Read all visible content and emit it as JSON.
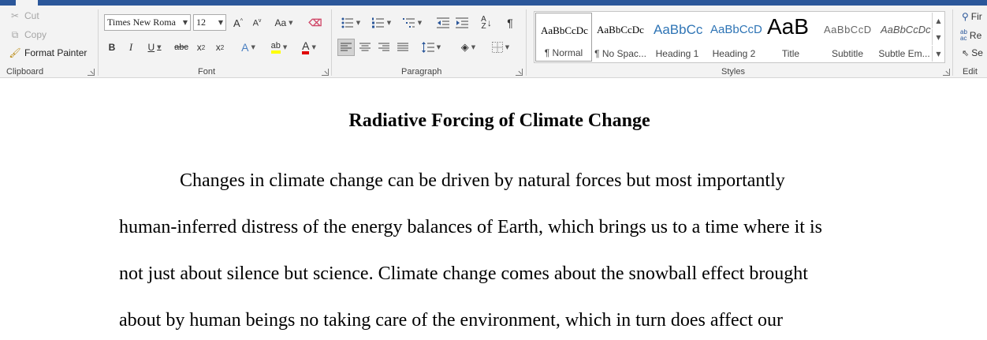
{
  "clipboard": {
    "cut": "Cut",
    "copy": "Copy",
    "format_painter": "Format Painter",
    "group_label": "Clipboard"
  },
  "font": {
    "family": "Times New Roma",
    "size": "12",
    "change_case": "Aa",
    "bold": "B",
    "italic": "I",
    "underline": "U",
    "strikethrough": "abc",
    "subscript": "x",
    "subscript_mark": "2",
    "superscript": "x",
    "superscript_mark": "2",
    "text_effects": "A",
    "font_color": "A",
    "group_label": "Font",
    "highlight_color": "#ffff00",
    "font_color_value": "#e00000"
  },
  "paragraph": {
    "group_label": "Paragraph",
    "show_marks": "¶"
  },
  "styles": {
    "group_label": "Styles",
    "items": [
      {
        "sample": "AaBbCcDc",
        "name": "¶ Normal"
      },
      {
        "sample": "AaBbCcDc",
        "name": "¶ No Spac..."
      },
      {
        "sample": "AaBbCc",
        "name": "Heading 1"
      },
      {
        "sample": "AaBbCcD",
        "name": "Heading 2"
      },
      {
        "sample": "AaB",
        "name": "Title"
      },
      {
        "sample": "AaBbCcD",
        "name": "Subtitle"
      },
      {
        "sample": "AaBbCcDc",
        "name": "Subtle Em..."
      }
    ]
  },
  "editing": {
    "find": "Fir",
    "replace": "Re",
    "select": "Se",
    "group_label": "Edit"
  },
  "document": {
    "title": "Radiative Forcing of Climate Change",
    "lines": [
      "Changes in climate change can be driven by natural forces but most importantly",
      "human-inferred distress of the energy balances of Earth, which brings us to a time where it is",
      "not just about silence but science. Climate change comes about the snowball effect brought",
      "about by human beings no taking care of the environment, which in turn does affect our"
    ]
  }
}
